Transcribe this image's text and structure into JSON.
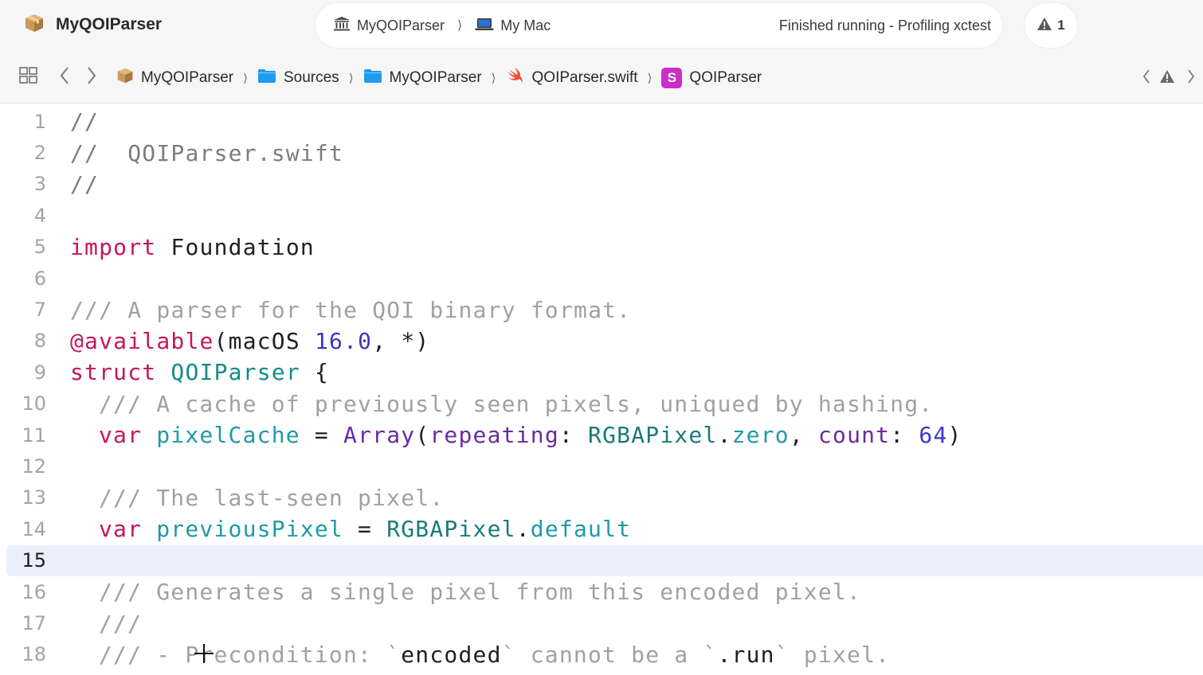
{
  "toolbar": {
    "project_name": "MyQOIParser",
    "scheme": "MyQOIParser",
    "destination": "My Mac",
    "status": "Finished running - Profiling xctest",
    "warning_count": "1"
  },
  "jumpbar": {
    "crumbs": [
      {
        "label": "MyQOIParser",
        "icon": "package-icon"
      },
      {
        "label": "Sources",
        "icon": "folder-icon"
      },
      {
        "label": "MyQOIParser",
        "icon": "folder-icon"
      },
      {
        "label": "QOIParser.swift",
        "icon": "swift-file-icon"
      },
      {
        "label": "QOIParser",
        "icon": "struct-icon",
        "badge": "S"
      }
    ]
  },
  "editor": {
    "current_line": 15,
    "lines": [
      {
        "n": "1"
      },
      {
        "n": "2"
      },
      {
        "n": "3"
      },
      {
        "n": "4"
      },
      {
        "n": "5"
      },
      {
        "n": "6"
      },
      {
        "n": "7"
      },
      {
        "n": "8"
      },
      {
        "n": "9"
      },
      {
        "n": "10"
      },
      {
        "n": "11"
      },
      {
        "n": "12"
      },
      {
        "n": "13"
      },
      {
        "n": "14"
      },
      {
        "n": "15"
      },
      {
        "n": "16"
      },
      {
        "n": "17"
      },
      {
        "n": "18"
      }
    ],
    "code": {
      "l1": "//",
      "l2": "//  QOIParser.swift",
      "l3": "//",
      "l5_kw": "import",
      "l5_rest": " Foundation",
      "l7": "/// A parser for the QOI binary format.",
      "l8_attr": "@available",
      "l8_a": "(macOS ",
      "l8_num": "16.0",
      "l8_b": ", *)",
      "l9_kw": "struct",
      "l9_sp": " ",
      "l9_type": "QOIParser",
      "l9_rest": " {",
      "l10": "/// A cache of previously seen pixels, uniqued by hashing.",
      "l11_kw": "var",
      "l11_name": " pixelCache",
      "l11_eq": " = ",
      "l11_type": "Array",
      "l11_p1": "(",
      "l11_param": "repeating",
      "l11_c": ": ",
      "l11_type2": "RGBAPixel",
      "l11_dot": ".",
      "l11_prop": "zero",
      "l11_comma": ", ",
      "l11_param2": "count",
      "l11_c2": ": ",
      "l11_num": "64",
      "l11_end": ")",
      "l13": "/// The last-seen pixel.",
      "l14_kw": "var",
      "l14_name": " previousPixel",
      "l14_eq": " = ",
      "l14_type": "RGBAPixel",
      "l14_dot": ".",
      "l14_prop": "default",
      "l16": "/// Generates a single pixel from this encoded pixel.",
      "l17": "///",
      "l18_a": "/// - Precondition: ",
      "l18_b": "`",
      "l18_c": "encoded",
      "l18_d": "`",
      "l18_e": " cannot be a ",
      "l18_f": "`",
      "l18_g": ".run",
      "l18_h": "`",
      "l18_i": " pixel."
    }
  },
  "colors": {
    "keyword": "#c6155d",
    "comment": "#7d7d7d",
    "number": "#3b37c6",
    "type": "#168a8a",
    "property": "#1f9aa8",
    "parameter": "#6b2aa0",
    "current_line_bg": "#e9f0fb"
  }
}
